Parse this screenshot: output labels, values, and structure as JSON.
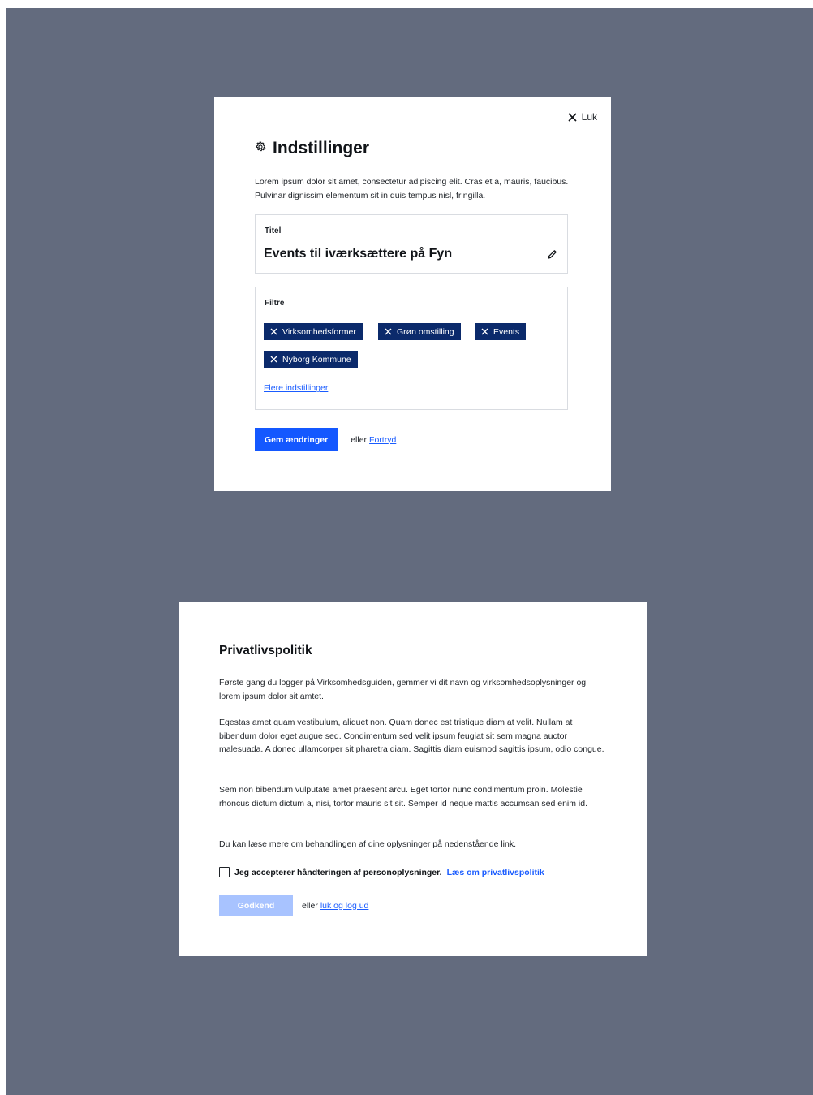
{
  "settings": {
    "close_label": "Luk",
    "title": "Indstillinger",
    "description": "Lorem ipsum dolor sit amet, consectetur adipiscing elit. Cras et a, mauris, faucibus. Pulvinar dignissim elementum sit in duis tempus nisl, fringilla.",
    "title_field": {
      "label": "Titel",
      "value": "Events til iværksættere på Fyn"
    },
    "filters": {
      "label": "Filtre",
      "chips": [
        "Virksomhedsformer",
        "Grøn omstilling",
        "Events",
        "Nyborg Kommune"
      ],
      "more_link": "Flere indstillinger"
    },
    "save_label": "Gem ændringer",
    "or_label": "eller",
    "cancel_label": "Fortryd"
  },
  "privacy": {
    "title": "Privatlivspolitik",
    "paragraphs": [
      "Første gang du logger på Virksomhedsguiden, gemmer vi dit navn og virksomhedsoplysninger og lorem ipsum dolor sit amtet.",
      "Egestas amet quam vestibulum, aliquet non. Quam donec est tristique diam at velit. Nullam at bibendum dolor eget augue sed. Condimentum sed velit ipsum feugiat sit sem magna auctor malesuada. A donec ullamcorper sit pharetra diam. Sagittis diam euismod sagittis ipsum, odio congue.",
      "Sem non bibendum vulputate amet praesent arcu. Eget tortor nunc condimentum proin. Molestie rhoncus dictum dictum a, nisi, tortor mauris sit sit. Semper id neque mattis accumsan sed enim id.",
      "Du kan læse mere om behandlingen af dine oplysninger på nedenstående link."
    ],
    "consent_text": "Jeg accepterer håndteringen af personoplysninger.",
    "consent_link": "Læs om privatlivspolitik",
    "approve_label": "Godkend",
    "or_label": "eller",
    "logout_label": "luk og log ud"
  },
  "colors": {
    "backdrop": "#636b7e",
    "primary": "#1458ff",
    "chip": "#0b2a6b",
    "disabled": "#a8c3ff",
    "link": "#1a5cff"
  },
  "icons": {
    "close": "close-icon",
    "settings": "gear-icon",
    "edit": "pencil-icon",
    "chip_remove": "close-icon"
  }
}
